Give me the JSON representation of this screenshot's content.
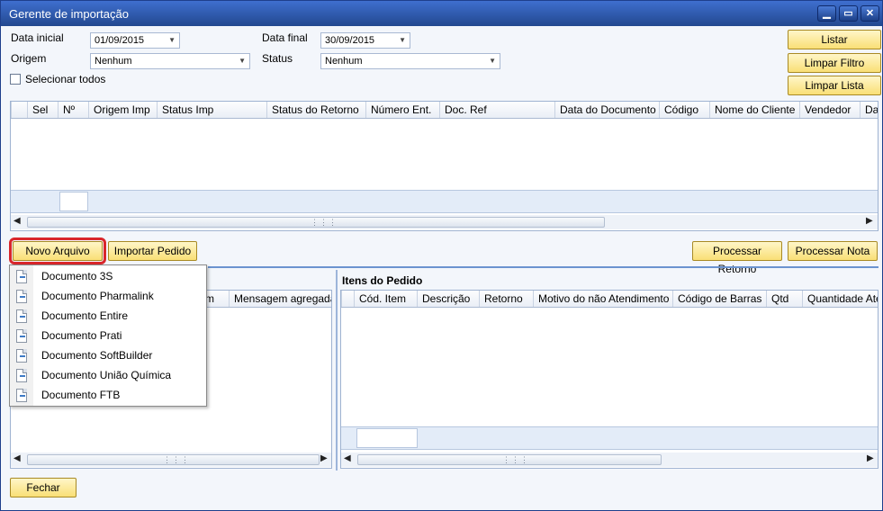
{
  "window": {
    "title": "Gerente de importação",
    "minimize": "▁",
    "maximize": "▭",
    "close": "✕"
  },
  "filters": {
    "data_inicial_label": "Data inicial",
    "data_inicial_value": "01/09/2015",
    "data_final_label": "Data final",
    "data_final_value": "30/09/2015",
    "origem_label": "Origem",
    "origem_value": "Nenhum",
    "status_label": "Status",
    "status_value": "Nenhum",
    "selecionar_todos_label": "Selecionar todos"
  },
  "actions": {
    "listar": "Listar",
    "limpar_filtro": "Limpar Filtro",
    "limpar_lista": "Limpar Lista",
    "novo_arquivo": "Novo Arquivo",
    "importar_pedido": "Importar Pedido",
    "processar_retorno": "Processar Retorno",
    "processar_nota": "Processar Nota",
    "fechar": "Fechar"
  },
  "main_grid": {
    "columns": [
      "Sel",
      "Nº",
      "Origem Imp",
      "Status Imp",
      "Status do Retorno",
      "Número Ent.",
      "Doc. Ref",
      "Data do Documento",
      "Código",
      "Nome do Cliente",
      "Vendedor",
      "Da"
    ]
  },
  "left_grid": {
    "visible_columns": [
      "m",
      "Mensagem agregada"
    ]
  },
  "items_panel": {
    "title": "Itens do Pedido",
    "columns": [
      "Cód. Item",
      "Descrição",
      "Retorno",
      "Motivo do não Atendimento",
      "Código de Barras",
      "Qtd",
      "Quantidade Aten"
    ]
  },
  "menu": {
    "items": [
      "Documento 3S",
      "Documento Pharmalink",
      "Documento Entire",
      "Documento Prati",
      "Documento SoftBuilder",
      "Documento União Química",
      "Documento FTB"
    ]
  },
  "scroll": {
    "left_arrow": "◀",
    "right_arrow": "▶",
    "grip": "⋮⋮⋮"
  },
  "colors": {
    "title_bar": "#2b55a8",
    "button_fill": "#f9df76",
    "highlight": "#d9262b"
  }
}
